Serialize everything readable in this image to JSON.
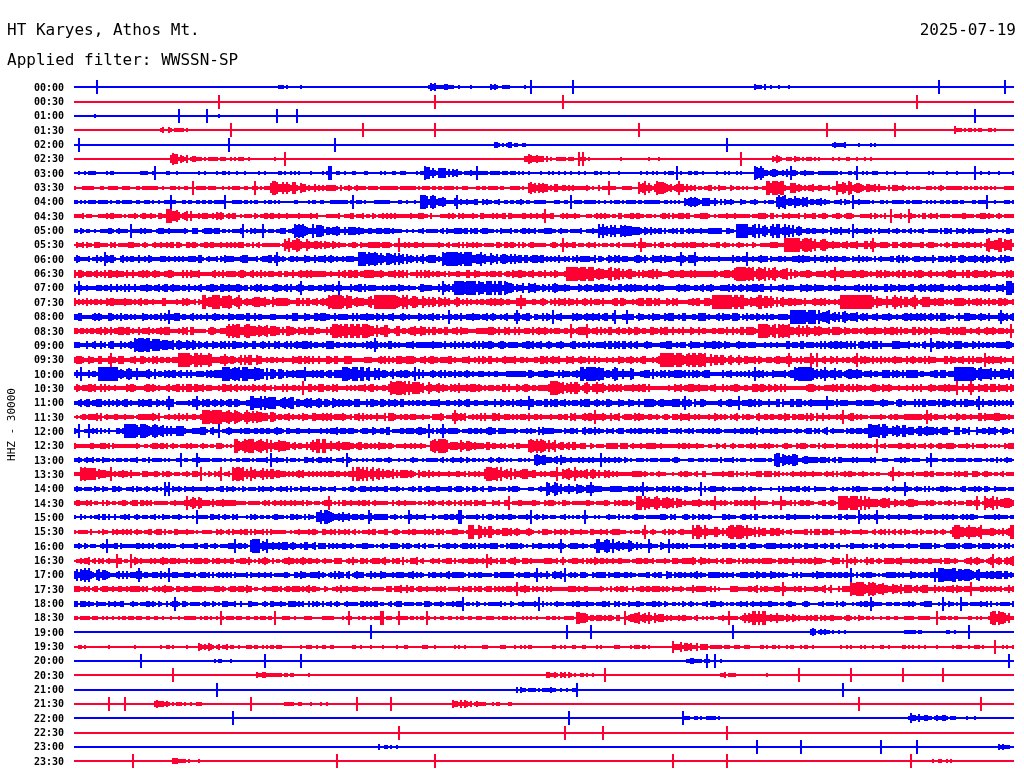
{
  "title": "HT Karyes, Athos Mt.",
  "date": "2025-07-19",
  "filter": "Applied filter: WWSSN-SP",
  "axis_label": "HHZ - 30000",
  "rows": [
    {
      "time": "00:00",
      "color": "#0000ff"
    },
    {
      "time": "00:30",
      "color": "#ff0033"
    },
    {
      "time": "01:00",
      "color": "#0000ff"
    },
    {
      "time": "01:30",
      "color": "#ff0033"
    },
    {
      "time": "02:00",
      "color": "#0000ff"
    },
    {
      "time": "02:30",
      "color": "#ff0033"
    },
    {
      "time": "03:00",
      "color": "#0000ff"
    },
    {
      "time": "03:30",
      "color": "#ff0033"
    },
    {
      "time": "04:00",
      "color": "#0000ff"
    },
    {
      "time": "04:30",
      "color": "#ff0033"
    },
    {
      "time": "05:00",
      "color": "#0000ff"
    },
    {
      "time": "05:30",
      "color": "#ff0033"
    },
    {
      "time": "06:00",
      "color": "#0000ff"
    },
    {
      "time": "06:30",
      "color": "#ff0033"
    },
    {
      "time": "07:00",
      "color": "#0000ff"
    },
    {
      "time": "07:30",
      "color": "#ff0033"
    },
    {
      "time": "08:00",
      "color": "#0000ff"
    },
    {
      "time": "08:30",
      "color": "#ff0033"
    },
    {
      "time": "09:00",
      "color": "#0000ff"
    },
    {
      "time": "09:30",
      "color": "#ff0033"
    },
    {
      "time": "10:00",
      "color": "#0000ff"
    },
    {
      "time": "10:30",
      "color": "#ff0033"
    },
    {
      "time": "11:00",
      "color": "#0000ff"
    },
    {
      "time": "11:30",
      "color": "#ff0033"
    },
    {
      "time": "12:00",
      "color": "#0000ff"
    },
    {
      "time": "12:30",
      "color": "#ff0033"
    },
    {
      "time": "13:00",
      "color": "#0000ff"
    },
    {
      "time": "13:30",
      "color": "#ff0033"
    },
    {
      "time": "14:00",
      "color": "#0000ff"
    },
    {
      "time": "14:30",
      "color": "#ff0033"
    },
    {
      "time": "15:00",
      "color": "#0000ff"
    },
    {
      "time": "15:30",
      "color": "#ff0033"
    },
    {
      "time": "16:00",
      "color": "#0000ff"
    },
    {
      "time": "16:30",
      "color": "#ff0033"
    },
    {
      "time": "17:00",
      "color": "#0000ff"
    },
    {
      "time": "17:30",
      "color": "#ff0033"
    },
    {
      "time": "18:00",
      "color": "#0000ff"
    },
    {
      "time": "18:30",
      "color": "#ff0033"
    },
    {
      "time": "19:00",
      "color": "#0000ff"
    },
    {
      "time": "19:30",
      "color": "#ff0033"
    },
    {
      "time": "20:00",
      "color": "#0000ff"
    },
    {
      "time": "20:30",
      "color": "#ff0033"
    },
    {
      "time": "21:00",
      "color": "#0000ff"
    },
    {
      "time": "21:30",
      "color": "#ff0033"
    },
    {
      "time": "22:00",
      "color": "#0000ff"
    },
    {
      "time": "22:30",
      "color": "#ff0033"
    },
    {
      "time": "23:00",
      "color": "#0000ff"
    },
    {
      "time": "23:30",
      "color": "#ff0033"
    }
  ]
}
